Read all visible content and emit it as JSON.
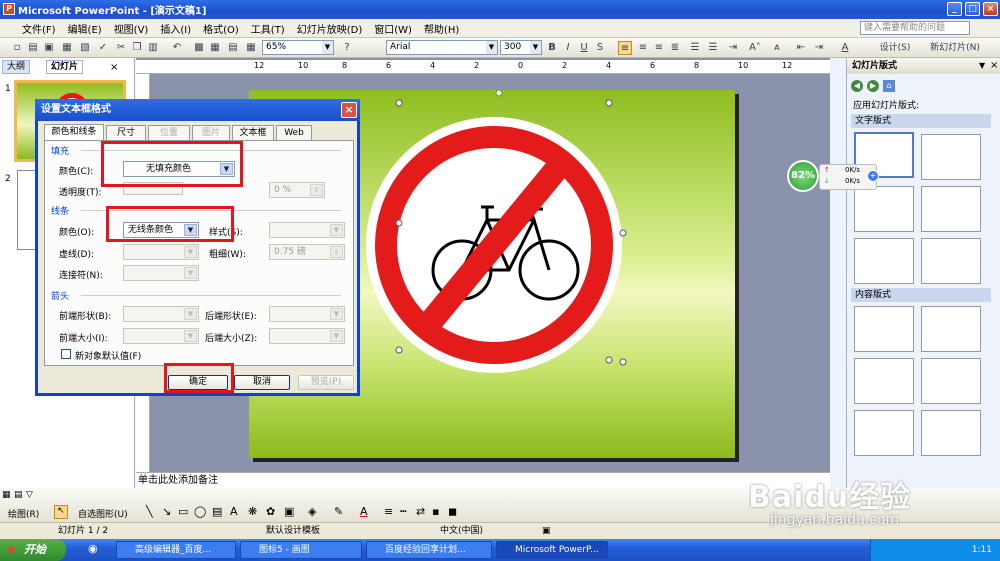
{
  "window": {
    "title": "Microsoft PowerPoint - [演示文稿1]"
  },
  "menubar": {
    "items": [
      "文件(F)",
      "编辑(E)",
      "视图(V)",
      "插入(I)",
      "格式(O)",
      "工具(T)",
      "幻灯片放映(D)",
      "窗口(W)",
      "帮助(H)"
    ],
    "help_placeholder": "键入需要帮助的问题"
  },
  "toolbar": {
    "zoom": "65%",
    "font": "Arial",
    "font_size": "300",
    "bold": "B",
    "italic": "I",
    "underline": "U",
    "shadow": "S",
    "font_grow": "A˄",
    "font_color": "A",
    "design": "设计(S)",
    "new_slide": "新幻灯片(N)"
  },
  "left_pane": {
    "tab_outline": "大纲",
    "tab_slides": "幻灯片",
    "slide_numbers": [
      "1",
      "2"
    ]
  },
  "ruler": {
    "marks": [
      "12",
      "10",
      "8",
      "6",
      "4",
      "2",
      "0",
      "2",
      "4",
      "6",
      "8",
      "10",
      "12"
    ]
  },
  "notes": {
    "placeholder": "单击此处添加备注"
  },
  "task_pane": {
    "title": "幻灯片版式",
    "apply_label": "应用幻灯片版式:",
    "section_text": "文字版式",
    "section_content": "内容版式"
  },
  "network_widget": {
    "percent": "82%",
    "up": "0K/s",
    "down": "0K/s"
  },
  "dialog": {
    "title": "设置文本框格式",
    "tabs": [
      "颜色和线条",
      "尺寸",
      "位置",
      "图片",
      "文本框",
      "Web"
    ],
    "fill_group": "填充",
    "fill_color_label": "颜色(C):",
    "fill_color_value": "无填充颜色",
    "transparency_label": "透明度(T):",
    "transparency_value": "0 %",
    "line_group": "线条",
    "line_color_label": "颜色(O):",
    "line_color_value": "无线条颜色",
    "style_label": "样式(S):",
    "dash_label": "虚线(D):",
    "weight_label": "粗细(W):",
    "weight_value": "0.75 磅",
    "connector_label": "连接符(N):",
    "arrows_group": "箭头",
    "begin_style_label": "前端形状(B):",
    "end_style_label": "后端形状(E):",
    "begin_size_label": "前端大小(I):",
    "end_size_label": "后端大小(Z):",
    "default_checkbox_label": "新对象默认值(F)",
    "ok_label": "确定",
    "cancel_label": "取消",
    "preview_label": "预览(P)"
  },
  "drawbar": {
    "draw_label": "绘图(R)",
    "autoshape_label": "自选图形(U)"
  },
  "status": {
    "slide": "幻灯片 1 / 2",
    "template": "默认设计模板",
    "language": "中文(中国)"
  },
  "taskbar": {
    "start": "开始",
    "tasks": [
      "高级编辑器_百度...",
      "图标5 - 画图",
      "百度经验回享计划...",
      "Microsoft PowerP..."
    ],
    "clock": "1:11"
  },
  "watermark": {
    "brand": "Baidu经验",
    "url": "jingyan.baidu.com"
  }
}
